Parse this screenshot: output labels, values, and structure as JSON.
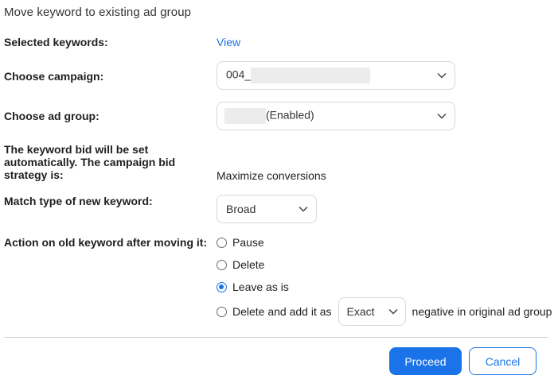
{
  "dialog": {
    "title": "Move keyword to existing ad group"
  },
  "selected_keywords": {
    "label": "Selected keywords:",
    "link": "View"
  },
  "campaign": {
    "label": "Choose campaign:",
    "value": "004_",
    "icon": "chevron-down-icon"
  },
  "ad_group": {
    "label": "Choose ad group:",
    "value": "(Enabled)",
    "icon": "chevron-down-icon"
  },
  "bid_strategy": {
    "label": "The keyword bid will be set automatically. The campaign bid strategy is:",
    "value": "Maximize conversions"
  },
  "match_type": {
    "label": "Match type of new keyword:",
    "value": "Broad",
    "icon": "chevron-down-icon"
  },
  "old_keyword_action": {
    "label": "Action on old keyword after moving it:",
    "options": [
      {
        "label": "Pause",
        "checked": false
      },
      {
        "label": "Delete",
        "checked": false
      },
      {
        "label": "Leave as is",
        "checked": true
      },
      {
        "label": "Delete and add it as",
        "checked": false
      }
    ],
    "negative_match_value": "Exact",
    "negative_suffix": "negative in original ad group"
  },
  "buttons": {
    "proceed": "Proceed",
    "cancel": "Cancel"
  },
  "colors": {
    "accent": "#1a73e8",
    "border": "#d8d8d8",
    "divider": "#d0d0d0",
    "redaction": "#ececec"
  }
}
